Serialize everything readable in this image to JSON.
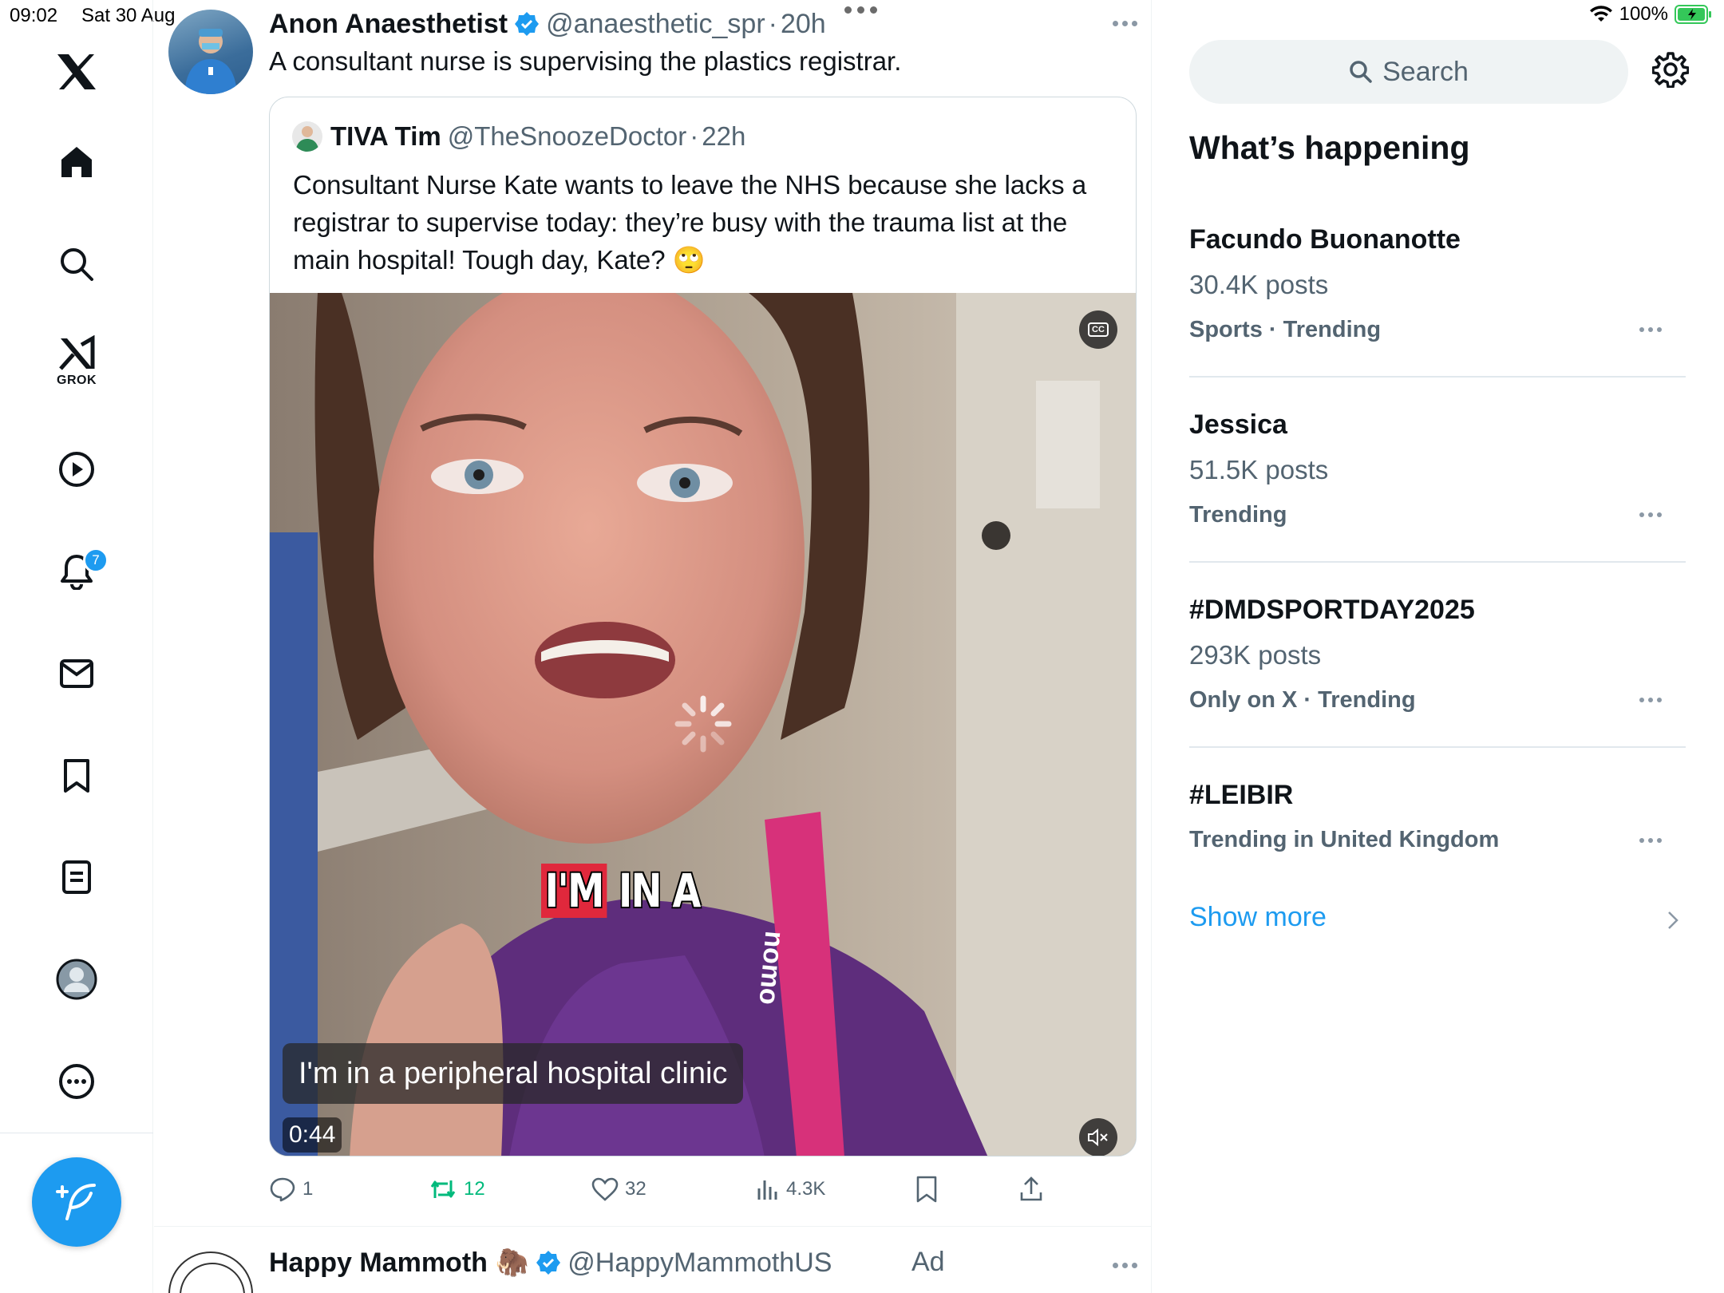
{
  "status": {
    "time": "09:02",
    "date": "Sat 30 Aug",
    "battery": "100%"
  },
  "nav": {
    "grok_label": "GROK",
    "notifications_badge": "7"
  },
  "tweet": {
    "name": "Anon Anaesthetist",
    "handle": "@anaesthetic_spr",
    "time": "20h",
    "text": "A consultant nurse is supervising the plastics registrar."
  },
  "quote": {
    "name": "TIVA Tim",
    "handle": "@TheSnoozeDoctor",
    "time": "22h",
    "text": "Consultant Nurse Kate wants to leave the NHS because she lacks a registrar to supervise today: they’re busy with the trauma list at the main hospital! Tough day, Kate? 🙄",
    "video": {
      "burned_text_a": "I'M",
      "burned_text_b": " IN A",
      "caption": "I'm in a peripheral hospital clinic",
      "duration": "0:44",
      "cc_label": "CC",
      "lanyard_text": "nomo"
    }
  },
  "actions": {
    "replies": "1",
    "reposts": "12",
    "likes": "32",
    "views": "4.3K"
  },
  "next_tweet": {
    "name": "Happy Mammoth",
    "emoji": "🦣",
    "handle": "@HappyMammothUS",
    "ad_label": "Ad"
  },
  "sidebar": {
    "search_placeholder": "Search",
    "title": "What’s happening",
    "trends": [
      {
        "name": "Facundo Buonanotte",
        "posts": "30.4K posts",
        "context": "Sports · Trending"
      },
      {
        "name": "Jessica",
        "posts": "51.5K posts",
        "context": "Trending"
      },
      {
        "name": "#DMDSPORTDAY2025",
        "posts": "293K posts",
        "context": "Only on X · Trending"
      },
      {
        "name": "#LEIBIR",
        "posts": "",
        "context": "Trending in United Kingdom"
      }
    ],
    "show_more": "Show more"
  },
  "colors": {
    "accent": "#1d9bf0",
    "repost_green": "#00ba7c",
    "text": "#0f1419",
    "muted": "#536471"
  }
}
